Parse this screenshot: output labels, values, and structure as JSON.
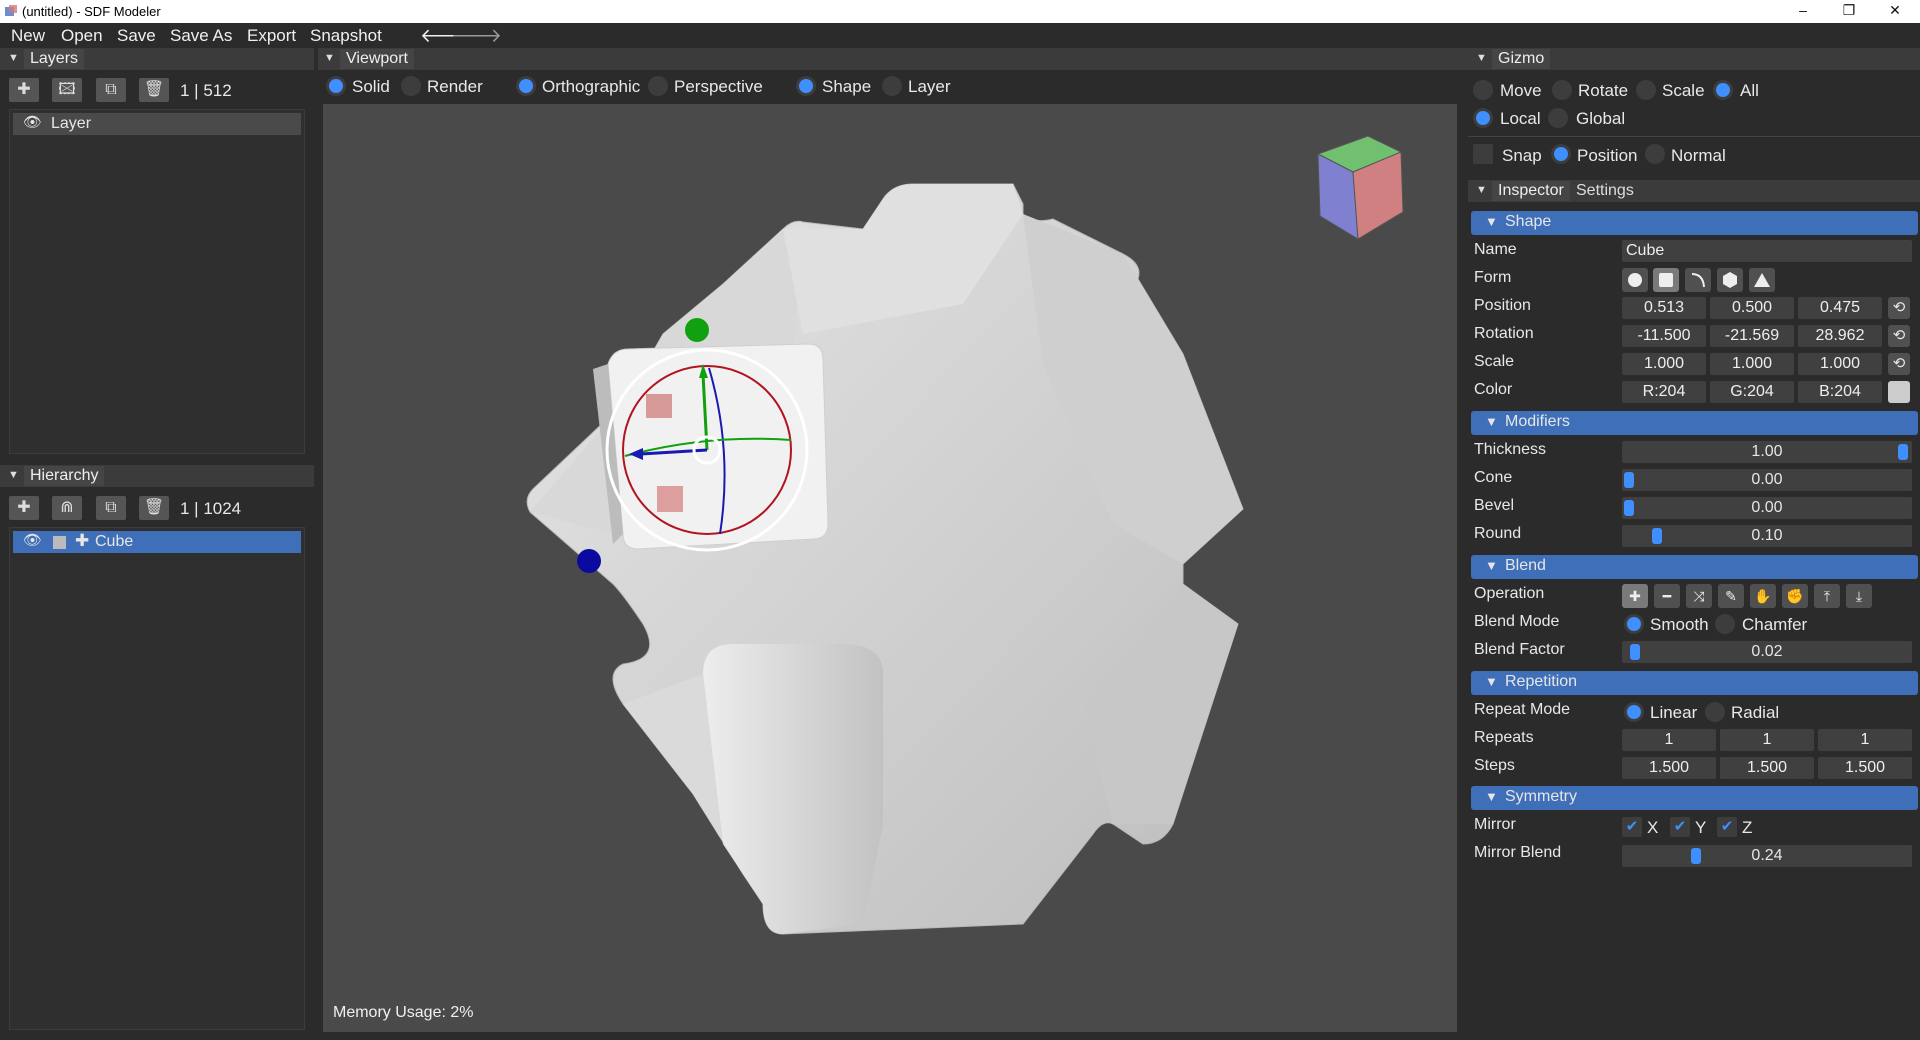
{
  "window": {
    "title": "(untitled) - SDF Modeler",
    "minimize": "–",
    "maximize": "❐",
    "close": "✕"
  },
  "menu": {
    "new": "New",
    "open": "Open",
    "save": "Save",
    "save_as": "Save As",
    "export": "Export",
    "snapshot": "Snapshot",
    "back_icon": "arrow-left-icon",
    "forward_icon": "arrow-right-icon"
  },
  "layers": {
    "title": "Layers",
    "count": "1 | 512",
    "items": [
      {
        "label": "Layer"
      }
    ]
  },
  "hierarchy": {
    "title": "Hierarchy",
    "count": "1 | 1024",
    "items": [
      {
        "label": "Cube"
      }
    ]
  },
  "viewport": {
    "title": "Viewport",
    "shading": {
      "solid": "Solid",
      "render": "Render",
      "selected": "Solid"
    },
    "projection": {
      "orthographic": "Orthographic",
      "perspective": "Perspective",
      "selected": "Orthographic"
    },
    "select_mode": {
      "shape": "Shape",
      "layer": "Layer",
      "selected": "Shape"
    },
    "memory": "Memory Usage: 2%"
  },
  "gizmo": {
    "title": "Gizmo",
    "modes": {
      "move": "Move",
      "rotate": "Rotate",
      "scale": "Scale",
      "all": "All",
      "selected": "All"
    },
    "space": {
      "local": "Local",
      "global": "Global",
      "selected": "Local"
    },
    "snap": {
      "snap": "Snap",
      "position": "Position",
      "normal": "Normal",
      "selected": "Position"
    }
  },
  "inspector": {
    "tabs": {
      "inspector": "Inspector",
      "settings": "Settings"
    },
    "shape": {
      "header": "Shape",
      "name_label": "Name",
      "name": "Cube",
      "form_label": "Form",
      "position_label": "Position",
      "position": [
        "0.513",
        "0.500",
        "0.475"
      ],
      "rotation_label": "Rotation",
      "rotation": [
        "-11.500",
        "-21.569",
        "28.962"
      ],
      "scale_label": "Scale",
      "scale": [
        "1.000",
        "1.000",
        "1.000"
      ],
      "color_label": "Color",
      "color": [
        "R:204",
        "G:204",
        "B:204"
      ],
      "color_hex": "#cccccc"
    },
    "modifiers": {
      "header": "Modifiers",
      "thickness_label": "Thickness",
      "thickness": "1.00",
      "cone_label": "Cone",
      "cone": "0.00",
      "bevel_label": "Bevel",
      "bevel": "0.00",
      "round_label": "Round",
      "round": "0.10"
    },
    "blend": {
      "header": "Blend",
      "operation_label": "Operation",
      "blend_mode_label": "Blend Mode",
      "smooth": "Smooth",
      "chamfer": "Chamfer",
      "selected": "Smooth",
      "blend_factor_label": "Blend Factor",
      "blend_factor": "0.02"
    },
    "repetition": {
      "header": "Repetition",
      "repeat_mode_label": "Repeat Mode",
      "linear": "Linear",
      "radial": "Radial",
      "selected": "Linear",
      "repeats_label": "Repeats",
      "repeats": [
        "1",
        "1",
        "1"
      ],
      "steps_label": "Steps",
      "steps": [
        "1.500",
        "1.500",
        "1.500"
      ]
    },
    "symmetry": {
      "header": "Symmetry",
      "mirror_label": "Mirror",
      "x": "X",
      "y": "Y",
      "z": "Z",
      "mirror_blend_label": "Mirror Blend",
      "mirror_blend": "0.24"
    }
  },
  "colors": {
    "accent": "#3f8fff",
    "section": "#3f6fb8",
    "panel": "#2b2b2b"
  }
}
